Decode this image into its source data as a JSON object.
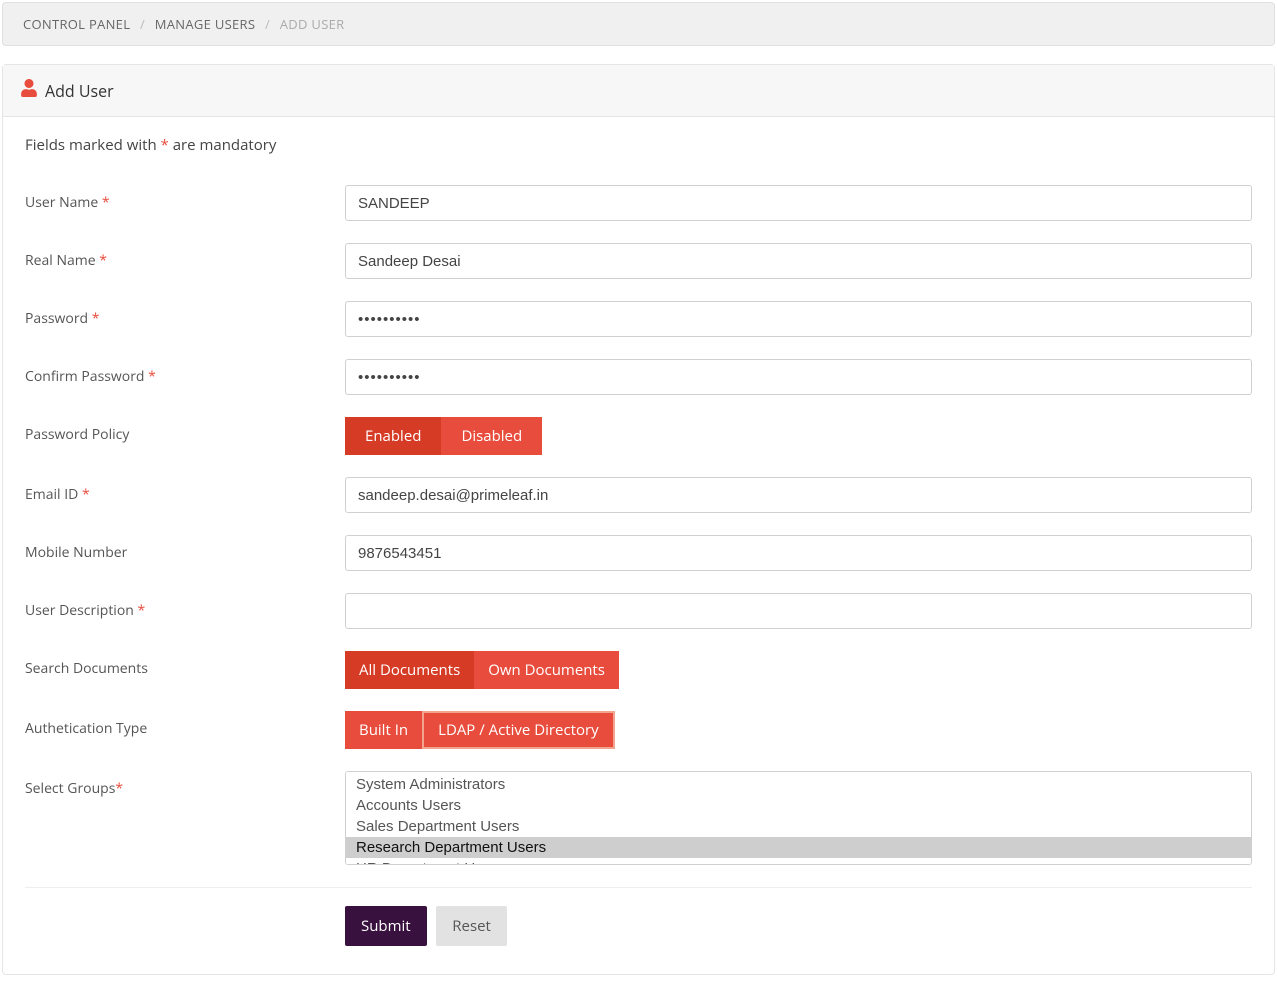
{
  "breadcrumb": {
    "items": [
      {
        "label": "CONTROL PANEL"
      },
      {
        "label": "MANAGE USERS"
      },
      {
        "label": "ADD USER"
      }
    ]
  },
  "panel": {
    "title": "Add User"
  },
  "mandatory_note": {
    "prefix": "Fields marked with ",
    "star": "*",
    "suffix": " are mandatory"
  },
  "form": {
    "user_name": {
      "label": "User Name ",
      "req": "*",
      "value": "SANDEEP"
    },
    "real_name": {
      "label": "Real Name ",
      "req": "*",
      "value": "Sandeep Desai"
    },
    "password": {
      "label": "Password ",
      "req": "*",
      "value": "••••••••••"
    },
    "confirm_password": {
      "label": "Confirm Password ",
      "req": "*",
      "value": "••••••••••"
    },
    "password_policy": {
      "label": "Password Policy",
      "options": [
        "Enabled",
        "Disabled"
      ],
      "active_index": 0
    },
    "email": {
      "label": "Email ID ",
      "req": "*",
      "value": "sandeep.desai@primeleaf.in"
    },
    "mobile": {
      "label": "Mobile Number",
      "value": "9876543451"
    },
    "description": {
      "label": "User Description ",
      "req": "*",
      "value": ""
    },
    "search_docs": {
      "label": "Search Documents",
      "options": [
        "All Documents",
        "Own Documents"
      ],
      "active_index": 0
    },
    "auth_type": {
      "label": "Authetication Type",
      "options": [
        "Built In",
        "LDAP / Active Directory"
      ],
      "active_index": 0
    },
    "groups": {
      "label": "Select Groups",
      "req": "*",
      "options": [
        "System Administrators",
        "Accounts Users",
        "Sales Department Users",
        "Research Department Users",
        "HR Department Users"
      ],
      "selected_index": 3
    }
  },
  "actions": {
    "submit": "Submit",
    "reset": "Reset"
  }
}
